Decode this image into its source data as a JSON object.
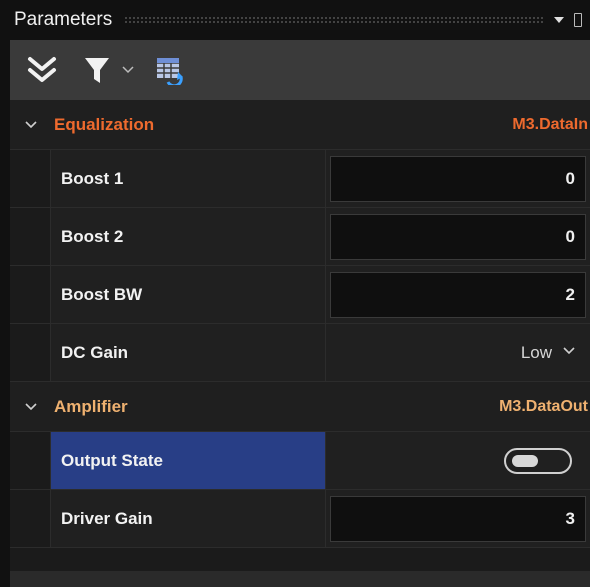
{
  "panel": {
    "title": "Parameters"
  },
  "toolbar": {
    "icons": [
      "collapse-all-icon",
      "filter-icon",
      "chevron-down-icon",
      "grid-refresh-icon"
    ]
  },
  "groups": [
    {
      "title": "Equalization",
      "source": "M3.DataIn",
      "color": "#ee6a2e",
      "properties": [
        {
          "label": "Boost 1",
          "value": "0"
        },
        {
          "label": "Boost 2",
          "value": "0"
        },
        {
          "label": "Boost BW",
          "value": "2"
        },
        {
          "label": "DC Gain",
          "value": "Low"
        }
      ]
    },
    {
      "title": "Amplifier",
      "source": "M3.DataOut",
      "color": "#efb170",
      "properties": [
        {
          "label": "Output State",
          "value": "off",
          "selected": true
        },
        {
          "label": "Driver Gain",
          "value": "3"
        }
      ]
    }
  ],
  "colors": {
    "selection": "#283e86",
    "toolbar_bg": "#3a3a3a",
    "panel_bg": "#1b1b1b"
  }
}
